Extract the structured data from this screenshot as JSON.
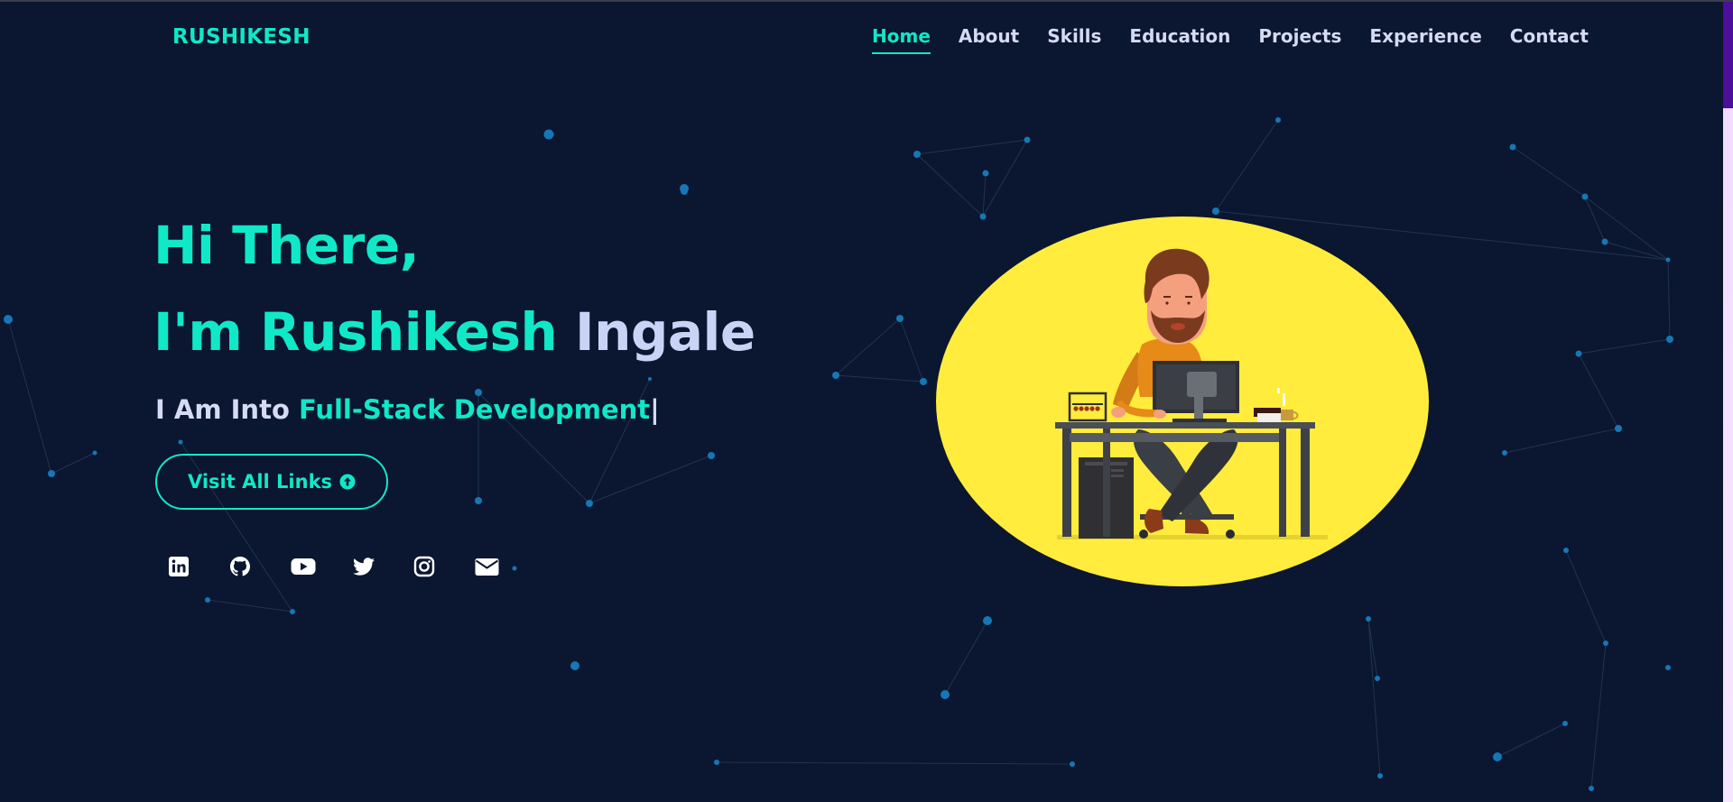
{
  "header": {
    "logo": "RUSHIKESH",
    "nav": [
      {
        "label": "Home",
        "active": true
      },
      {
        "label": "About",
        "active": false
      },
      {
        "label": "Skills",
        "active": false
      },
      {
        "label": "Education",
        "active": false
      },
      {
        "label": "Projects",
        "active": false
      },
      {
        "label": "Experience",
        "active": false
      },
      {
        "label": "Contact",
        "active": false
      }
    ]
  },
  "hero": {
    "greeting": "Hi There,",
    "intro_prefix": "I'm Rushikesh",
    "intro_surname": "Ingale",
    "sub_prefix": "I Am Into",
    "sub_typed": "Full-Stack Development",
    "sub_cursor": "|",
    "button_label": "Visit All Links",
    "button_icon": "arrow-up-circle-icon",
    "socials": [
      "linkedin-icon",
      "github-icon",
      "youtube-icon",
      "twitter-icon",
      "instagram-icon",
      "mail-icon"
    ]
  },
  "illustration": {
    "icon": "developer-at-desk-illustration",
    "background_color": "#ffec3d"
  },
  "theme": {
    "background": "#0b1630",
    "accent": "#10e8c8",
    "text": "#d5dbf2",
    "particle": "#1677b5"
  }
}
